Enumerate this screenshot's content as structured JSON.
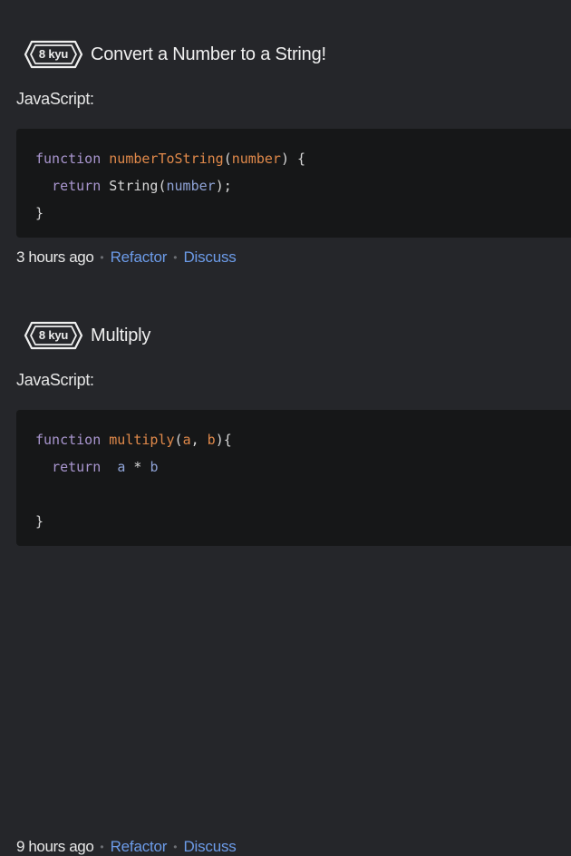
{
  "katas": [
    {
      "rank": "8 kyu",
      "title": "Convert a Number to a String!",
      "language": "JavaScript:",
      "code": [
        [
          {
            "t": "function",
            "c": "kw"
          },
          {
            "t": " ",
            "c": "plain"
          },
          {
            "t": "numberToString",
            "c": "fn"
          },
          {
            "t": "(",
            "c": "plain"
          },
          {
            "t": "number",
            "c": "fn"
          },
          {
            "t": ") {",
            "c": "plain"
          }
        ],
        [
          {
            "t": "  ",
            "c": "plain"
          },
          {
            "t": "return",
            "c": "kw"
          },
          {
            "t": " String(",
            "c": "plain"
          },
          {
            "t": "number",
            "c": "param"
          },
          {
            "t": ");",
            "c": "plain"
          }
        ],
        [
          {
            "t": "}",
            "c": "plain"
          }
        ]
      ],
      "time": "3 hours ago",
      "refactor_label": "Refactor",
      "discuss_label": "Discuss"
    },
    {
      "rank": "8 kyu",
      "title": "Multiply",
      "language": "JavaScript:",
      "code": [
        [
          {
            "t": "function",
            "c": "kw"
          },
          {
            "t": " ",
            "c": "plain"
          },
          {
            "t": "multiply",
            "c": "fn"
          },
          {
            "t": "(",
            "c": "plain"
          },
          {
            "t": "a",
            "c": "fn"
          },
          {
            "t": ", ",
            "c": "plain"
          },
          {
            "t": "b",
            "c": "fn"
          },
          {
            "t": "){",
            "c": "plain"
          }
        ],
        [
          {
            "t": "  ",
            "c": "plain"
          },
          {
            "t": "return",
            "c": "kw"
          },
          {
            "t": "  ",
            "c": "plain"
          },
          {
            "t": "a",
            "c": "param"
          },
          {
            "t": " * ",
            "c": "plain"
          },
          {
            "t": "b",
            "c": "param"
          }
        ],
        [],
        [
          {
            "t": "}",
            "c": "plain"
          }
        ]
      ],
      "time": "9 hours ago",
      "refactor_label": "Refactor",
      "discuss_label": "Discuss"
    }
  ],
  "separator": "•",
  "colors": {
    "background": "#25262a",
    "code_background": "#161718",
    "keyword": "#a996cf",
    "function_name": "#e0894a",
    "parameter": "#8fa3d6",
    "link": "#6c9be8"
  }
}
